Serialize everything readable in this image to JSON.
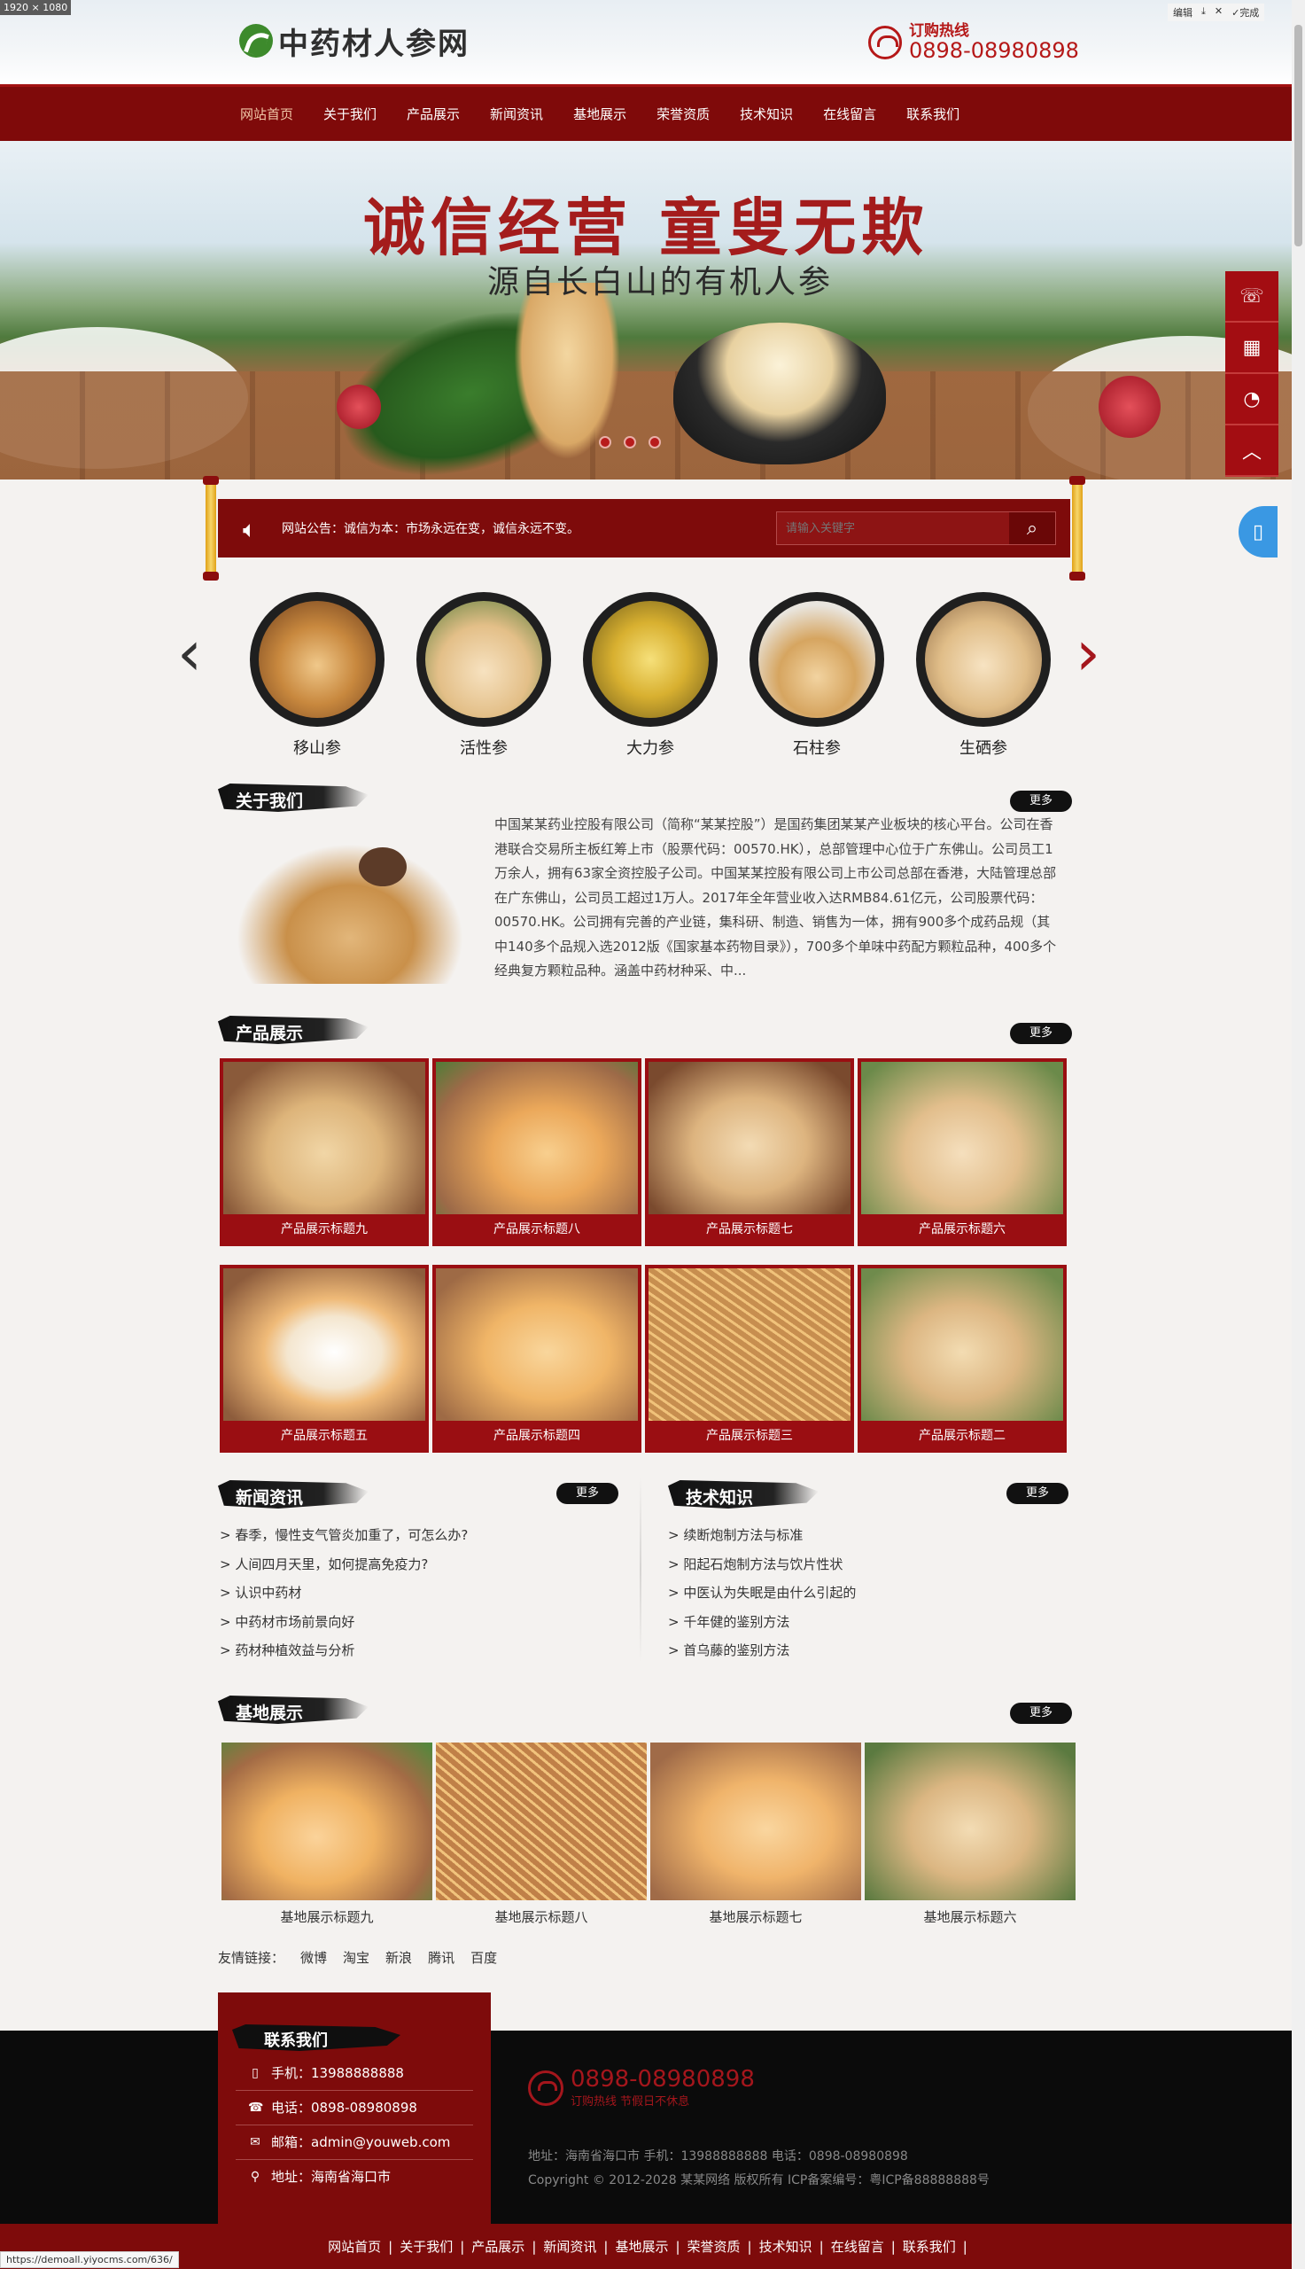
{
  "browser": {
    "dim_label": "1920 × 1080",
    "toolbar": [
      "编辑",
      "完成"
    ],
    "status_url": "https://demoall.yiyocms.com/636/"
  },
  "header": {
    "logo_text": "中药材人参网",
    "hotline_label": "订购热线",
    "hotline_number": "0898-08980898"
  },
  "nav": {
    "items": [
      "网站首页",
      "关于我们",
      "产品展示",
      "新闻资讯",
      "基地展示",
      "荣誉资质",
      "技术知识",
      "在线留言",
      "联系我们"
    ],
    "active_index": 0
  },
  "banner": {
    "slogan": "诚信经营 童叟无欺",
    "subtitle": "源自长白山的有机人参",
    "slide_count": 3
  },
  "notice": {
    "text": "网站公告：诚信为本：市场永远在变，诚信永远不变。",
    "search_placeholder": "请输入关键字"
  },
  "categories": [
    {
      "name": "移山参"
    },
    {
      "name": "活性参"
    },
    {
      "name": "大力参"
    },
    {
      "name": "石柱参"
    },
    {
      "name": "生硒参"
    }
  ],
  "about": {
    "title": "关于我们",
    "more": "更多",
    "text": "中国某某药业控股有限公司（简称“某某控股”）是国药集团某某产业板块的核心平台。公司在香港联合交易所主板红筹上市（股票代码：00570.HK），总部管理中心位于广东佛山。公司员工1万余人，拥有63家全资控股子公司。中国某某控股有限公司上市公司总部在香港，大陆管理总部在广东佛山，公司员工超过1万人。2017年全年营业收入达RMB84.61亿元，公司股票代码：00570.HK。公司拥有完善的产业链，集科研、制造、销售为一体，拥有900多个成药品规（其中140多个品规入选2012版《国家基本药物目录》），700多个单味中药配方颗粒品种，400多个经典复方颗粒品种。涵盖中药材种采、中..."
  },
  "products": {
    "title": "产品展示",
    "more": "更多",
    "items": [
      "产品展示标题九",
      "产品展示标题八",
      "产品展示标题七",
      "产品展示标题六",
      "产品展示标题五",
      "产品展示标题四",
      "产品展示标题三",
      "产品展示标题二"
    ]
  },
  "news": {
    "title": "新闻资讯",
    "more": "更多",
    "items": [
      "> 春季，慢性支气管炎加重了，可怎么办?",
      "> 人间四月天里，如何提高免疫力?",
      "> 认识中药材",
      "> 中药材市场前景向好",
      "> 药材种植效益与分析"
    ]
  },
  "tech": {
    "title": "技术知识",
    "more": "更多",
    "items": [
      "> 续断炮制方法与标准",
      "> 阳起石炮制方法与饮片性状",
      "> 中医认为失眠是由什么引起的",
      "> 千年健的鉴别方法",
      "> 首乌藤的鉴别方法"
    ]
  },
  "bases": {
    "title": "基地展示",
    "more": "更多",
    "items": [
      "基地展示标题九",
      "基地展示标题八",
      "基地展示标题七",
      "基地展示标题六"
    ]
  },
  "links": {
    "label": "友情链接：",
    "items": [
      "微博",
      "淘宝",
      "新浪",
      "腾讯",
      "百度"
    ]
  },
  "contact": {
    "title": "联系我们",
    "mobile": "手机：13988888888",
    "phone": "电话：0898-08980898",
    "email": "邮箱：admin@youweb.com",
    "address": "地址：海南省海口市"
  },
  "footer": {
    "phone": "0898-08980898",
    "phone_sub": "订购热线 节假日不休息",
    "address_line": "地址：海南省海口市   手机：13988888888   电话：0898-08980898",
    "copyright": "Copyright © 2012-2028 某某网络 版权所有   ICP备案编号：粤ICP备88888888号"
  },
  "bottom_nav": [
    "网站首页",
    "关于我们",
    "产品展示",
    "新闻资讯",
    "基地展示",
    "荣誉资质",
    "技术知识",
    "在线留言",
    "联系我们"
  ],
  "colors": {
    "brand_red": "#7e0b0b",
    "accent_red": "#a4161c",
    "footer_black": "#0b0b0b",
    "float_blue": "#3a98e3"
  }
}
